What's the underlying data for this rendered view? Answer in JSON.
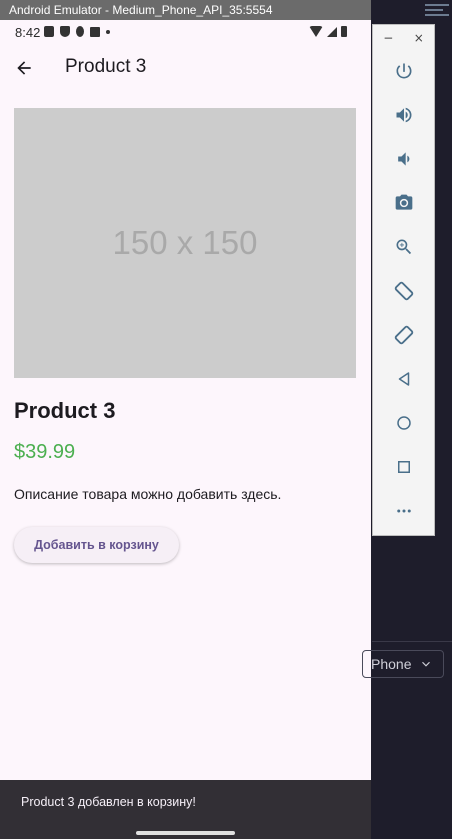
{
  "window": {
    "title": "Android Emulator - Medium_Phone_API_35:5554"
  },
  "statusbar": {
    "time": "8:42"
  },
  "appbar": {
    "title": "Product 3",
    "back_icon": "arrow-back-icon"
  },
  "product": {
    "image_placeholder": "150 x 150",
    "name": "Product 3",
    "price": "$39.99",
    "description": "Описание товара можно добавить здесь.",
    "add_button_label": "Добавить в корзину",
    "price_color": "#4caf50"
  },
  "snackbar": {
    "message": "Product 3 добавлен в корзину!"
  },
  "emulator_toolbar": {
    "minimize": "−",
    "close": "×",
    "buttons": [
      "power-icon",
      "volume-up-icon",
      "volume-down-icon",
      "camera-icon",
      "zoom-icon",
      "rotate-left-icon",
      "rotate-right-icon",
      "back-nav-icon",
      "home-nav-icon",
      "overview-nav-icon",
      "more-icon"
    ]
  },
  "ide": {
    "device_select_value": "Phone"
  },
  "colors": {
    "accent": "#65558f",
    "background": "#fdf6fc",
    "snackbar": "#322f35"
  }
}
